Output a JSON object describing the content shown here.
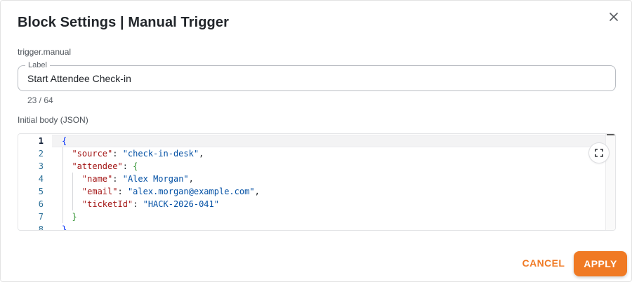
{
  "dialog": {
    "title": "Block Settings | Manual Trigger",
    "close_icon": "close-icon",
    "block_type": "trigger.manual"
  },
  "label_field": {
    "legend": "Label",
    "value": "Start Attendee Check-in",
    "char_count": "23 / 64"
  },
  "json_editor": {
    "label": "Initial body (JSON)",
    "fullscreen_icon": "fullscreen-icon",
    "line_numbers": [
      "1",
      "2",
      "3",
      "4",
      "5",
      "6",
      "7",
      "8"
    ],
    "lines": [
      [
        {
          "t": "{",
          "c": "b1"
        }
      ],
      [
        {
          "t": "  ",
          "c": "p"
        },
        {
          "t": "\"source\"",
          "c": "key"
        },
        {
          "t": ": ",
          "c": "p"
        },
        {
          "t": "\"check-in-desk\"",
          "c": "str"
        },
        {
          "t": ",",
          "c": "p"
        }
      ],
      [
        {
          "t": "  ",
          "c": "p"
        },
        {
          "t": "\"attendee\"",
          "c": "key"
        },
        {
          "t": ": ",
          "c": "p"
        },
        {
          "t": "{",
          "c": "b2"
        }
      ],
      [
        {
          "t": "    ",
          "c": "p"
        },
        {
          "t": "\"name\"",
          "c": "key"
        },
        {
          "t": ": ",
          "c": "p"
        },
        {
          "t": "\"Alex Morgan\"",
          "c": "str"
        },
        {
          "t": ",",
          "c": "p"
        }
      ],
      [
        {
          "t": "    ",
          "c": "p"
        },
        {
          "t": "\"email\"",
          "c": "key"
        },
        {
          "t": ": ",
          "c": "p"
        },
        {
          "t": "\"alex.morgan@example.com\"",
          "c": "str"
        },
        {
          "t": ",",
          "c": "p"
        }
      ],
      [
        {
          "t": "    ",
          "c": "p"
        },
        {
          "t": "\"ticketId\"",
          "c": "key"
        },
        {
          "t": ": ",
          "c": "p"
        },
        {
          "t": "\"HACK-2026-041\"",
          "c": "str"
        }
      ],
      [
        {
          "t": "  ",
          "c": "p"
        },
        {
          "t": "}",
          "c": "b2"
        }
      ],
      [
        {
          "t": "}",
          "c": "b1"
        }
      ]
    ],
    "active_line": 1
  },
  "actions": {
    "cancel_label": "CANCEL",
    "apply_label": "APPLY"
  },
  "colors": {
    "accent": "#f07a24",
    "json_key": "#a31515",
    "json_string": "#0451a5",
    "line_number": "#2a6f97"
  }
}
